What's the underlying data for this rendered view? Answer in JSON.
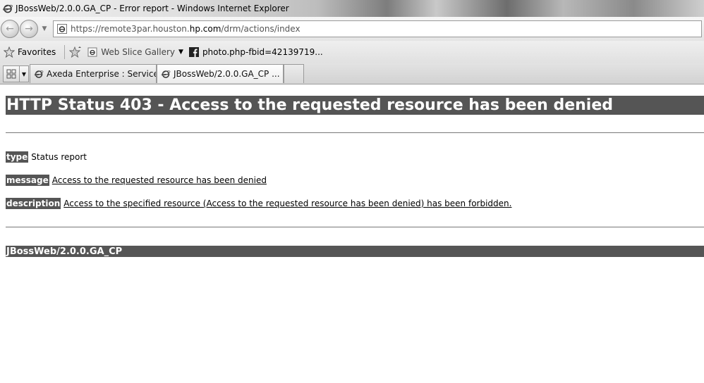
{
  "window": {
    "title": "JBossWeb/2.0.0.GA_CP - Error report - Windows Internet Explorer"
  },
  "addressbar": {
    "url_prefix": "https://remote3par.houston.",
    "url_domain": "hp.com",
    "url_suffix": "/drm/actions/index"
  },
  "favorites_bar": {
    "favorites_label": "Favorites",
    "items": [
      {
        "label": "Web Slice Gallery",
        "icon": "ie-page-icon",
        "has_dropdown": true
      },
      {
        "label": "photo.php-fbid=42139719...",
        "icon": "facebook-icon",
        "has_dropdown": false
      }
    ]
  },
  "tabs": [
    {
      "label": "Axeda Enterprise : Service",
      "active": false
    },
    {
      "label": "JBossWeb/2.0.0.GA_CP ...",
      "active": true,
      "close": "×"
    }
  ],
  "page": {
    "heading": "HTTP Status 403 - Access to the requested resource has been denied",
    "type_key": "type",
    "type_value": "Status report",
    "message_key": "message",
    "message_value": "Access to the requested resource has been denied",
    "description_key": "description",
    "description_value": "Access to the specified resource (Access to the requested resource has been denied) has been forbidden.",
    "footer": "JBossWeb/2.0.0.GA_CP"
  }
}
